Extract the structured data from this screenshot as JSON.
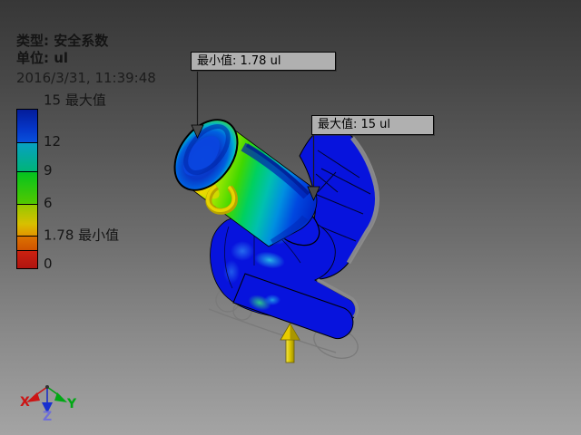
{
  "header": {
    "type_label": "类型: 安全系数",
    "unit_label": "单位: ul",
    "timestamp": "2016/3/31, 11:39:48"
  },
  "legend": {
    "labels": {
      "max": "15 最大值",
      "t12": "12",
      "t9": "9",
      "t6": "6",
      "min": "1.78 最小值",
      "zero": "0"
    },
    "scale": {
      "max": 15,
      "min": 1.78,
      "zero": 0,
      "unit": "ul",
      "tick_values": [
        15,
        12,
        9,
        6,
        1.78,
        0
      ]
    },
    "colors": {
      "blue": "#0536c8",
      "teal": "#00b478",
      "green": "#06c41e",
      "yellow": "#d8c000",
      "orange": "#dc7200",
      "red": "#b81410"
    }
  },
  "callouts": {
    "min_label": "最小值: 1.78 ul",
    "max_label": "最大值: 15 ul"
  },
  "triad": {
    "x": "X",
    "y": "Y",
    "z": "Z"
  },
  "result": {
    "type": "安全系数",
    "unit": "ul",
    "min_value": 1.78,
    "max_value": 15
  }
}
